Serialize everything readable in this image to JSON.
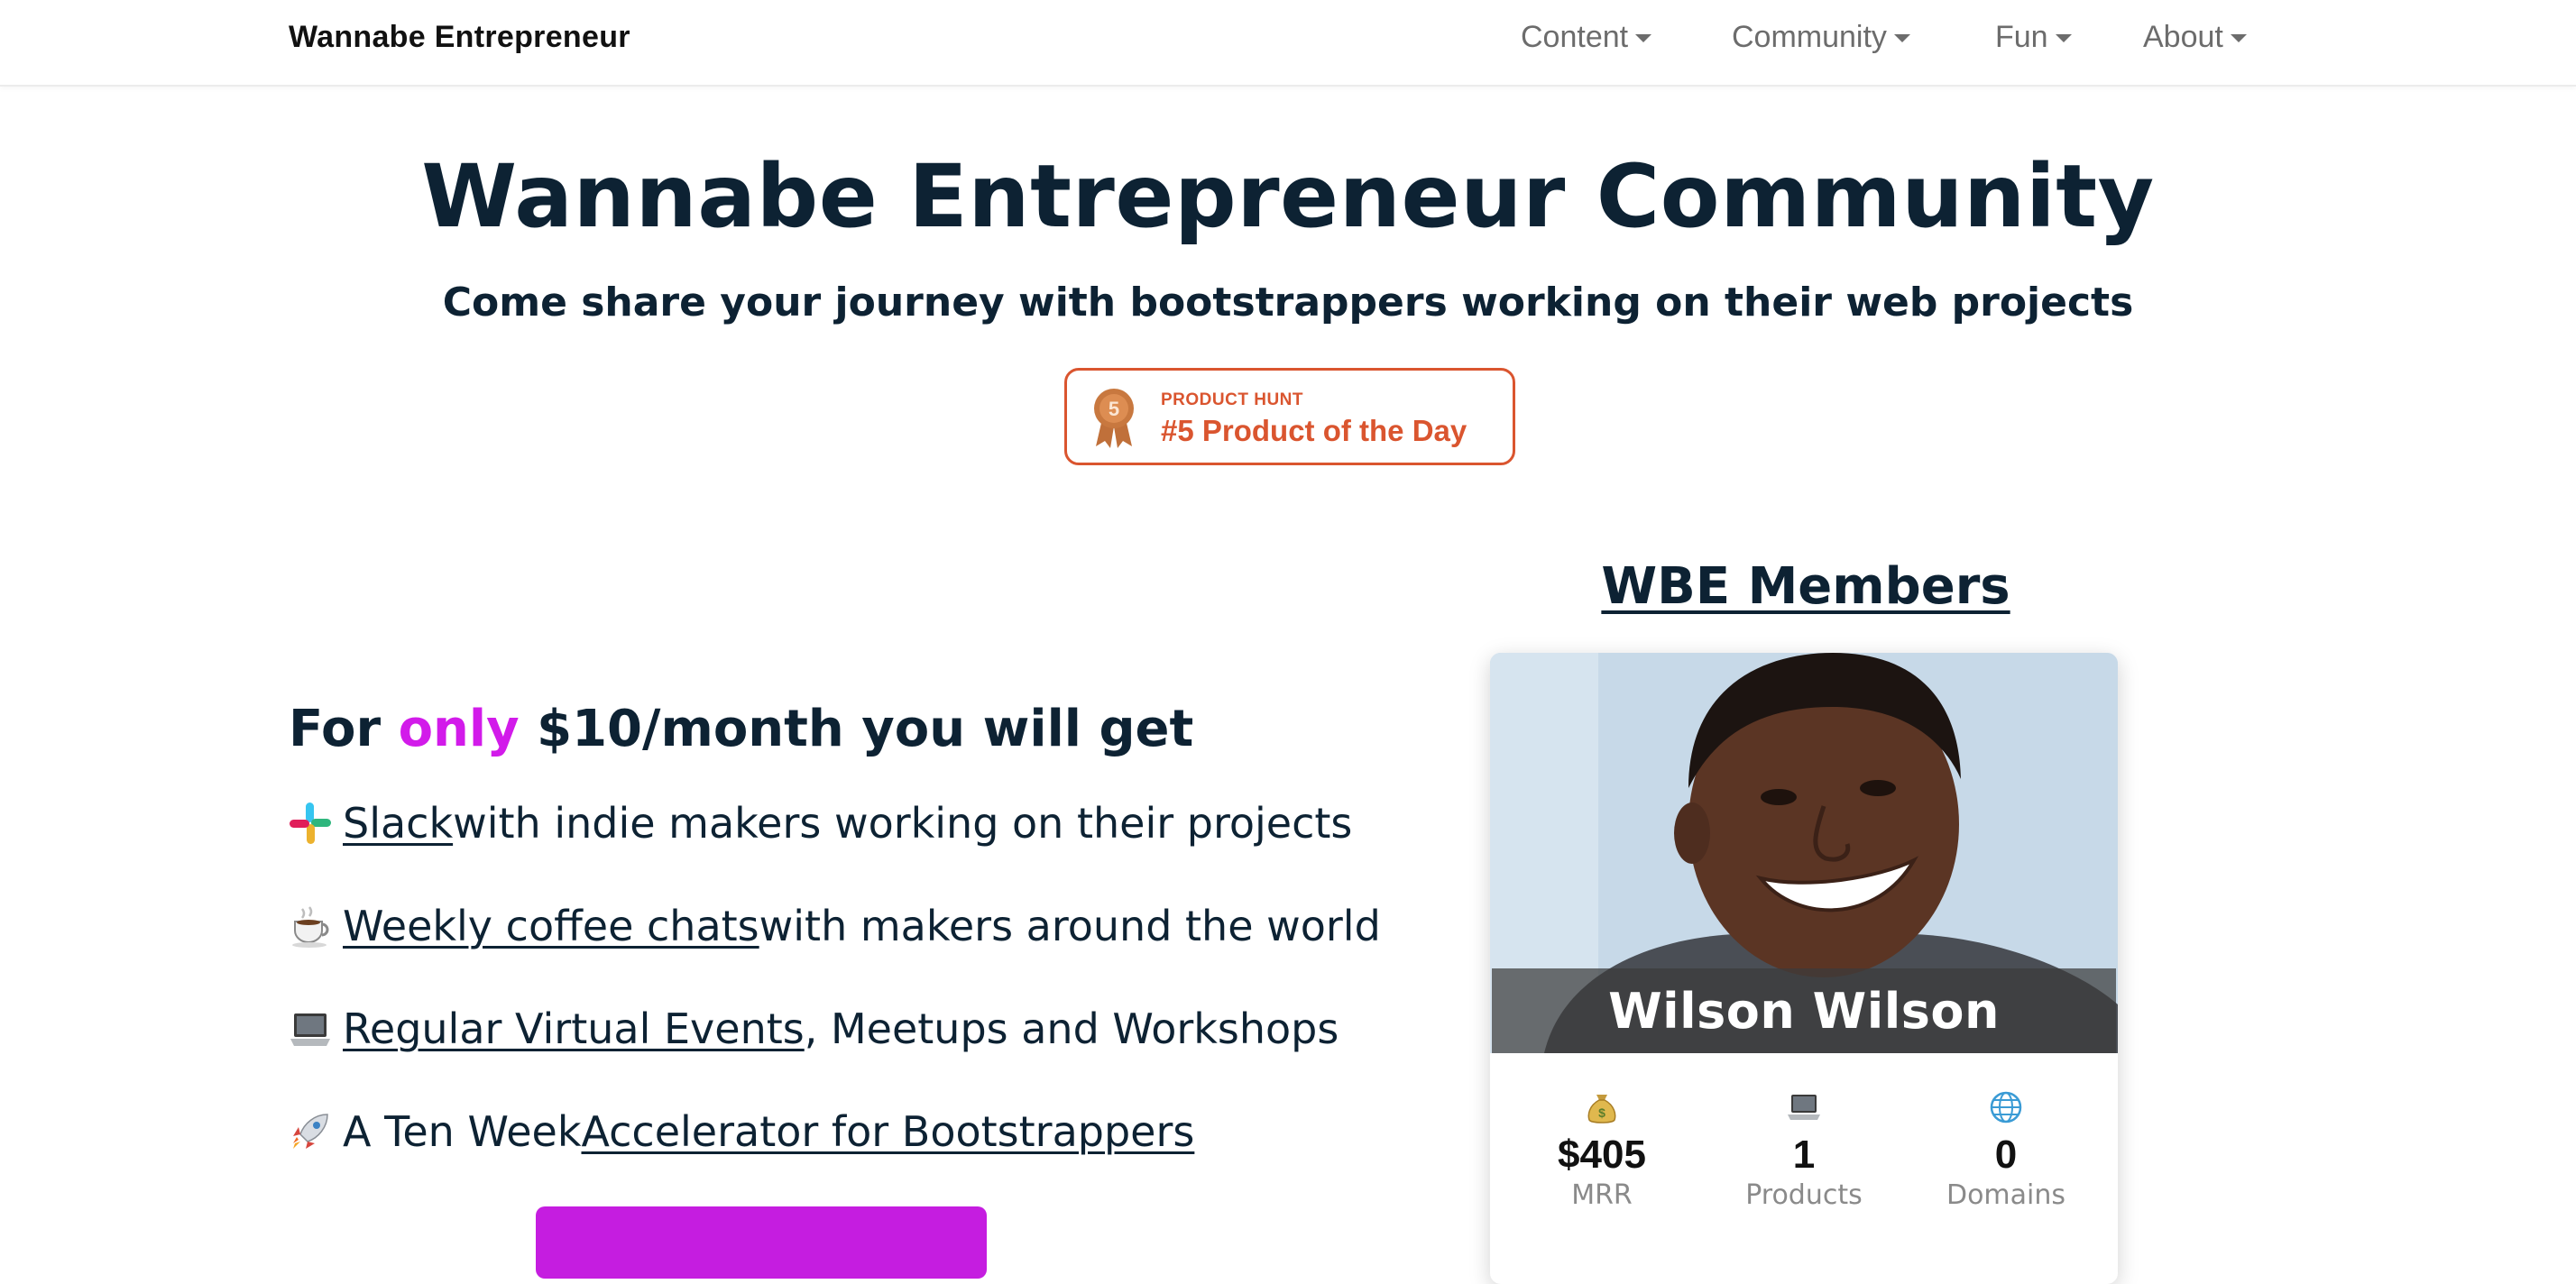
{
  "navbar": {
    "brand": "Wannabe Entrepreneur",
    "items": [
      {
        "label": "Content"
      },
      {
        "label": "Community"
      },
      {
        "label": "Fun"
      },
      {
        "label": "About"
      }
    ]
  },
  "hero": {
    "title": "Wannabe Entrepreneur Community",
    "subtitle": "Come share your journey with bootstrappers working on their web projects",
    "badge": {
      "medal_number": "5",
      "kicker": "PRODUCT HUNT",
      "title": "#5 Product of the Day"
    }
  },
  "offer": {
    "heading_prefix": "For ",
    "heading_accent": "only",
    "heading_suffix": " $10/month you will get",
    "perks": [
      {
        "icon": "slack-icon",
        "link": "Slack",
        "pre": "",
        "post": " with indie makers working on their projects"
      },
      {
        "icon": "coffee-icon",
        "link": "Weekly coffee chats",
        "pre": "",
        "post": " with makers around the world"
      },
      {
        "icon": "laptop-icon",
        "link": "Regular Virtual Events",
        "pre": "",
        "post": ", Meetups and Workshops"
      },
      {
        "icon": "rocket-icon",
        "link": "Accelerator for Bootstrappers",
        "pre": "A Ten Week ",
        "post": ""
      }
    ]
  },
  "members": {
    "heading": "WBE Members",
    "card": {
      "name": "Wilson Wilson",
      "stats": [
        {
          "icon": "money-bag-icon",
          "value": "$405",
          "label": "MRR"
        },
        {
          "icon": "laptop-icon",
          "value": "1",
          "label": "Products"
        },
        {
          "icon": "globe-icon",
          "value": "0",
          "label": "Domains"
        }
      ]
    }
  },
  "colors": {
    "text": "#0d2233",
    "accent_purple": "#d21bea",
    "cta_purple": "#c51de0",
    "product_hunt": "#da552f"
  }
}
